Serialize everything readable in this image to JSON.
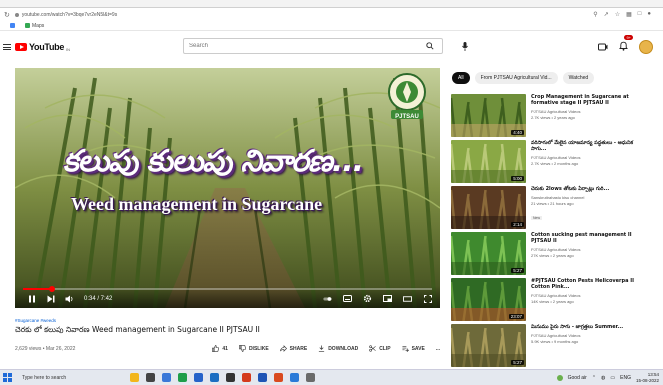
{
  "browser": {
    "url": "youtube.com/watch?v=3bqe7vr2eN5l&t=9s",
    "bookmarks": [
      {
        "label": "",
        "color": "#4285f4"
      },
      {
        "label": "Maps",
        "color": "#34a853"
      }
    ]
  },
  "header": {
    "wordmark": "YouTube",
    "country": "IN",
    "search_placeholder": "Search",
    "notification_count": "9+"
  },
  "player": {
    "overlay_telugu": "కలుపు కులుపు నివారణ...",
    "overlay_english": "Weed management in Sugarcane",
    "logo_text": "PJTSAU",
    "time": "0:34 / 7:42",
    "progress_fraction": 0.07
  },
  "video": {
    "hashtag": "#Sugarcane #weeds",
    "title": "చెరకు లో కలుపు నివారణ Weed management in Sugarcane II PJTSAU II",
    "views_date": "2,629 views • Mar 26, 2022",
    "actions": {
      "like": "41",
      "dislike": "DISLIKE",
      "share": "SHARE",
      "download": "DOWNLOAD",
      "clip": "CLIP",
      "save": "SAVE",
      "more": "..."
    }
  },
  "chips": [
    "All",
    "From PJTSAU Agricultural Vid...",
    "Watched"
  ],
  "recommendations": [
    {
      "title": "Crop Management in Sugarcane at formative stage II PJTSAU II",
      "channel": "PJTSAU Agricultural Videos",
      "stats": "2.7K views • 2 years ago",
      "duration": "4:40",
      "colors": [
        "#6f8f3a",
        "#3e5f1e",
        "#c9a86a"
      ]
    },
    {
      "title": "వరిసాగులో మేలైన యాజమాన్య పద్ధతులు - ఆధునిక సాగు...",
      "channel": "PJTSAU Agricultural Videos",
      "stats": "2.7K views • 2 months ago",
      "duration": "5:00",
      "colors": [
        "#8aa845",
        "#b9c978",
        "#4d6a22"
      ]
    },
    {
      "title": "చెరుకు 2lows తోటకు ఏర్పాట్లు గురి...",
      "channel": "Sanskrutirahastu kisu channel",
      "stats": "21 views • 21 hours ago",
      "badge": "New",
      "duration": "2:14",
      "colors": [
        "#5a3a22",
        "#8b6a3a",
        "#2a1a12"
      ]
    },
    {
      "title": "Cotton sucking pest management II PJTSAU II",
      "channel": "PJTSAU Agricultural Videos",
      "stats": "27K views • 2 years ago",
      "duration": "5:27",
      "colors": [
        "#3f8a2e",
        "#7dc254",
        "#2a5a1a"
      ]
    },
    {
      "title": "#PJTSAU Cotton Pests Helicoverpa II Cotton Pink...",
      "channel": "PJTSAU Agricultural Videos",
      "stats": "14K views • 2 years ago",
      "duration": "23:07",
      "colors": [
        "#2f6a24",
        "#5e9a3a",
        "#c94a2a"
      ]
    },
    {
      "title": "మినుము పైరు సాగు - జాగ్రత్తలు Summer...",
      "channel": "PJTSAU Agricultural Videos",
      "stats": "5.9K views • 9 months ago",
      "duration": "5:27",
      "colors": [
        "#6e6a3a",
        "#a89a5a",
        "#4e4a22"
      ]
    }
  ],
  "taskbar": {
    "search_placeholder": "Type here to search",
    "weather": "Good air",
    "lang": "ENG",
    "time": "13:54",
    "date": "15-08-2022",
    "app_colors": [
      "#f2b61c",
      "#444",
      "#3a78d8",
      "#1e9e4a",
      "#2563c9",
      "#1b6ec2",
      "#333",
      "#d43a1c",
      "#1e54b5",
      "#d94a1e",
      "#2a7ad8",
      "#6a6a6a"
    ]
  }
}
